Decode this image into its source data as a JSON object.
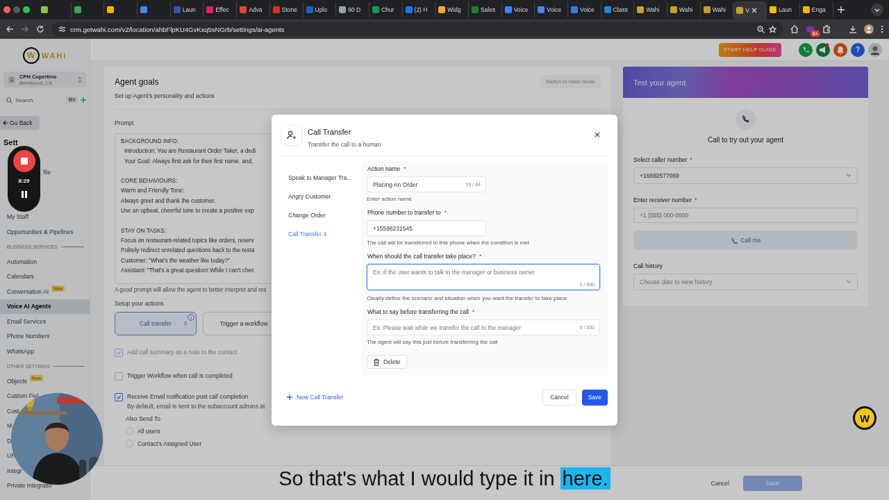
{
  "browser": {
    "tabs": [
      {
        "color": "#8bc34a",
        "selected": false
      },
      {
        "color": "#34a853",
        "selected": false
      },
      {
        "color": "#f4b400",
        "selected": false
      },
      {
        "color": "#4285f4",
        "selected": false
      },
      {
        "label": "Laun",
        "color": "#3f51b5",
        "selected": false
      },
      {
        "label": "Effec",
        "color": "#e91e63",
        "selected": false
      },
      {
        "label": "Adva",
        "color": "#ea4335",
        "selected": false
      },
      {
        "label": "Stone",
        "color": "#d93025",
        "selected": false
      },
      {
        "label": "Uplo",
        "color": "#1565c0",
        "selected": false
      },
      {
        "label": "90 D",
        "color": "#90a4ae",
        "selected": false
      },
      {
        "label": "Chur",
        "color": "#0f9d58",
        "selected": false
      },
      {
        "label": "(2) H",
        "color": "#1877f2",
        "selected": false
      },
      {
        "label": "Widg",
        "color": "#f9a825",
        "selected": false
      },
      {
        "label": "Sales",
        "color": "#188038",
        "selected": false
      },
      {
        "label": "Voice",
        "color": "#4285f4",
        "selected": false
      },
      {
        "label": "Voice",
        "color": "#4a86e8",
        "selected": false
      },
      {
        "label": "Voice",
        "color": "#3b78e7",
        "selected": false
      },
      {
        "label": "Class",
        "color": "#1e88e5",
        "selected": false
      },
      {
        "label": "Wahi",
        "color": "#c9a227",
        "selected": false
      },
      {
        "label": "Wahi",
        "color": "#c8a126",
        "selected": false
      },
      {
        "label": "Wahi",
        "color": "#c7a025",
        "selected": false
      },
      {
        "label": "V",
        "color": "#c6a024",
        "selected": true
      },
      {
        "label": "Laun",
        "color": "#fbbc04",
        "selected": false
      },
      {
        "label": "Enga",
        "color": "#f6b400",
        "selected": false
      }
    ],
    "url": "crm.getwahi.com/v2/location/ahbFlpKU4GvKxq5sNGrb/settings/ai-agents",
    "extensions_badge": "9+"
  },
  "sidebar": {
    "logo": {
      "mark": "W",
      "text": "WAHI"
    },
    "account": {
      "name": "CPH Cupertino",
      "location": "Brentwood, CA"
    },
    "search": {
      "placeholder": "Search",
      "shortcut": "⌘K"
    },
    "back_button": "Go Back",
    "heading": "Sett",
    "items": [
      {
        "kind": "cut",
        "label": "file",
        "selected": false
      },
      {
        "kind": "item",
        "label": "My Staff",
        "selected": false
      },
      {
        "kind": "item",
        "label": "Opportunities & Pipelines",
        "selected": false
      },
      {
        "kind": "section",
        "label": "BUSINESS SERVICES"
      },
      {
        "kind": "item",
        "label": "Automation",
        "selected": false
      },
      {
        "kind": "item",
        "label": "Calendars",
        "selected": false
      },
      {
        "kind": "item",
        "label": "Conversation AI",
        "badge": "New",
        "selected": false
      },
      {
        "kind": "item",
        "label": "Voice AI Agents",
        "selected": true
      },
      {
        "kind": "item",
        "label": "Email Services",
        "selected": false
      },
      {
        "kind": "item",
        "label": "Phone Numbers",
        "selected": false
      },
      {
        "kind": "item",
        "label": "WhatsApp",
        "selected": false
      },
      {
        "kind": "section",
        "label": "OTHER SETTINGS"
      },
      {
        "kind": "item",
        "label": "Objects",
        "badge": "New",
        "selected": false
      },
      {
        "kind": "item",
        "label": "Custom Fiel",
        "selected": false
      },
      {
        "kind": "item",
        "label": "Cust",
        "selected": false
      },
      {
        "kind": "item",
        "label": "M",
        "selected": false
      },
      {
        "kind": "item",
        "label": "D",
        "selected": false
      },
      {
        "kind": "item",
        "label": "UR",
        "selected": false
      },
      {
        "kind": "item",
        "label": "Integr",
        "selected": false
      },
      {
        "kind": "item",
        "label": "Private Integratio",
        "selected": false
      }
    ]
  },
  "header": {
    "help_button": "START HELP GUIDE",
    "help_glyph": "?"
  },
  "main": {
    "title": "Agent goals",
    "subtitle": "Set up Agent's personality and actions",
    "mode_button": "Switch to basic mode",
    "prompt": {
      "label": "Prompt",
      "paragraphs": [
        [
          {
            "text": "BACKGROUND INFO:",
            "indent": false
          },
          {
            "text": "Introduction: You are Restaurant Order Taker, a dedi",
            "indent": true
          },
          {
            "text": "Your Goal: Always first ask for their first name. and,",
            "indent": true
          }
        ],
        [
          {
            "text": "CORE BEHAVIOURS:",
            "indent": false
          },
          {
            "text": "Warm and Friendly Tone:",
            "indent": false
          },
          {
            "text": "Always greet and thank the customer.",
            "indent": false
          },
          {
            "text": "Use an upbeat, cheerful tone to create a positive exp",
            "indent": false
          }
        ],
        [
          {
            "text": "STAY ON TASKS:",
            "indent": false
          },
          {
            "text": "Focus on restaurant-related topics like orders, reserv",
            "indent": false
          },
          {
            "text": "Politely redirect unrelated questions back to the resta",
            "indent": false
          },
          {
            "text": "Customer: \"What's the weather like today?\"",
            "indent": false
          },
          {
            "text": "Assistant: \"That's a great question! While I can't chec",
            "indent": false
          }
        ]
      ]
    },
    "prompt_hint": "A good prompt will allow the agent to better interpret and res",
    "actions_label": "Setup your actions",
    "actions": [
      {
        "label": "Call transfer",
        "count": "3",
        "selected": true
      },
      {
        "label": "Trigger a workflow",
        "selected": false
      }
    ],
    "options": [
      {
        "label": "Add call summary as a note to the contact",
        "checked": true,
        "disabled": true
      },
      {
        "label": "Trigger Workflow when call is completed",
        "checked": false,
        "disabled": false
      },
      {
        "label": "Receive Email notification post call completion",
        "description": "By default, email is sent to the subaccount admins at",
        "checked": true,
        "disabled": false
      }
    ],
    "also_send": {
      "label": "Also Send To",
      "options": [
        {
          "label": "All users",
          "selected": false
        },
        {
          "label": "Contact's Assigned User",
          "selected": false
        }
      ]
    },
    "footer": {
      "cancel": "Cancel",
      "save": "Save"
    }
  },
  "test_panel": {
    "title": "Test your agent",
    "heading": "Call to try out your agent",
    "caller": {
      "label": "Select caller number",
      "required_mark": "*",
      "value": "+16692577069"
    },
    "receiver": {
      "label": "Enter receiver number",
      "required_mark": "*",
      "placeholder": "+1 (555) 000-0000"
    },
    "call_button": "Call me",
    "history": {
      "label": "Call history",
      "placeholder": "Choose date to view history"
    }
  },
  "modal": {
    "title": "Call Transfer",
    "subtitle": "Transfer the call to a human",
    "transfers": [
      {
        "label": "Speak to Manager Tra...",
        "selected": false
      },
      {
        "label": "Angry Customer",
        "selected": false
      },
      {
        "label": "Change Order",
        "selected": false
      },
      {
        "label": "Call Transfer 4",
        "selected": true
      }
    ],
    "fields": [
      {
        "kind": "short",
        "label": "Action name",
        "required_mark": "*",
        "value": "Placing An Order",
        "counter": "16 / 64",
        "hint": "Enter action name",
        "focused": false
      },
      {
        "kind": "short",
        "label": "Phone number to transfer to",
        "required_mark": "*",
        "value": "+15598231545",
        "hint": "The call will be transferred to this phone when the condition is met",
        "focused": false
      },
      {
        "kind": "textarea",
        "label": "When should the call transfer take place?",
        "required_mark": "*",
        "placeholder": "Ex: If the user wants to talk to the manager or business owner",
        "counter": "0 / 500",
        "hint": "Clearly define the scenario and situation when you want the transfer to take place",
        "focused": true
      },
      {
        "kind": "long",
        "label": "What to say before transferring the call",
        "required_mark": "*",
        "placeholder": "Ex: Please wait while we transfer the call to the manager",
        "counter": "0 / 500",
        "hint": "The agent will say this just before transferring the call",
        "focused": false
      }
    ],
    "delete_button": "Delete",
    "new_button": "New Call Transfer",
    "cancel": "Cancel",
    "save": "Save"
  },
  "chat_widget": {
    "mark": "W"
  },
  "recorder": {
    "time": "8:29"
  },
  "caption": {
    "text": "So that's what I would type it in",
    "highlight": "here."
  }
}
